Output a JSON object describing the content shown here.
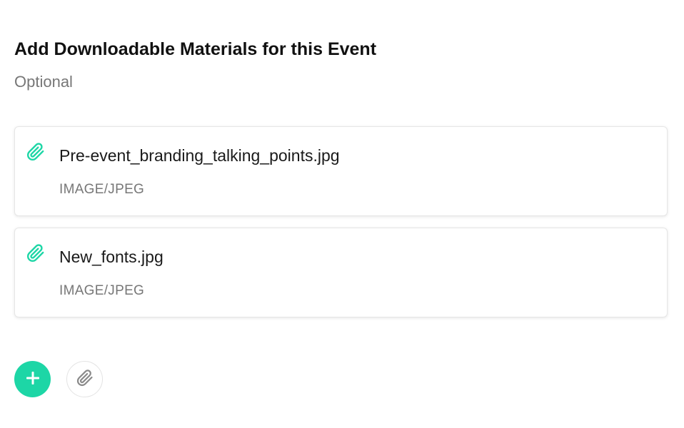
{
  "section": {
    "title": "Add Downloadable Materials for this Event",
    "subtitle": "Optional"
  },
  "files": [
    {
      "name": "Pre-event_branding_talking_points.jpg",
      "type": "IMAGE/JPEG"
    },
    {
      "name": "New_fonts.jpg",
      "type": "IMAGE/JPEG"
    }
  ],
  "actions": {
    "add_icon": "plus-icon",
    "attach_icon": "paperclip-icon"
  },
  "colors": {
    "accent": "#1dd6a6",
    "muted_text": "#777777",
    "attach_icon": "#8a8a8a"
  }
}
